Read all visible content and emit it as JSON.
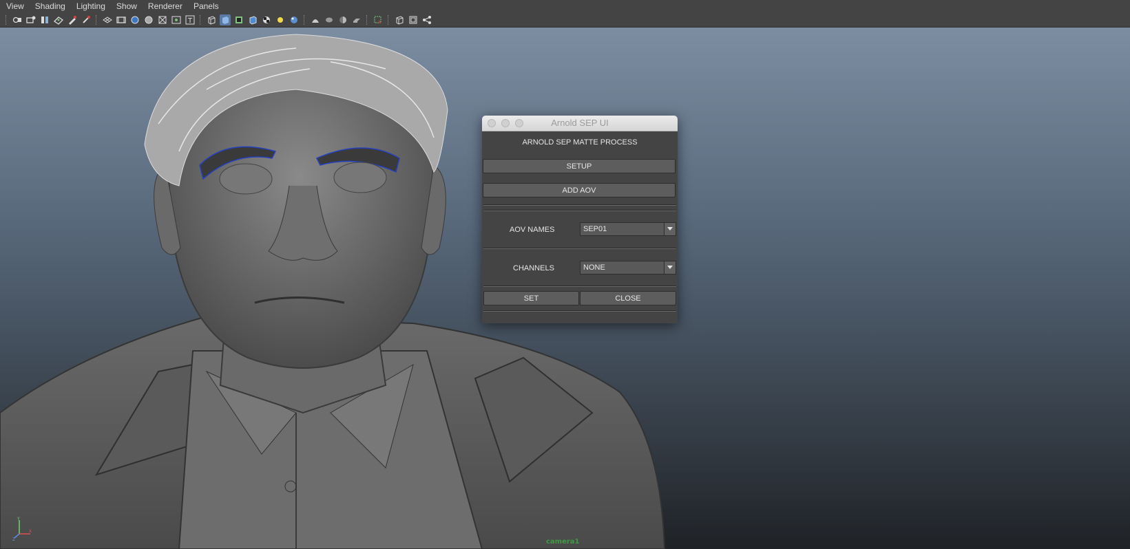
{
  "menubar": {
    "items": [
      "View",
      "Shading",
      "Lighting",
      "Show",
      "Renderer",
      "Panels"
    ]
  },
  "toolbar": {
    "icons": [
      "camera-select-icon",
      "camera-attributes-icon",
      "bookmark-icon",
      "image-plane-icon",
      "grease-pencil-icon",
      "2d-pan-zoom-icon",
      "grid-icon",
      "film-gate-icon",
      "resolution-gate-icon",
      "gate-mask-icon",
      "field-chart-icon",
      "safe-action-icon",
      "safe-title-icon",
      "wireframe-icon",
      "smooth-shade-icon",
      "wireframe-on-shaded-icon",
      "textured-icon",
      "use-lights-icon",
      "shadows-icon",
      "screen-space-ao-icon",
      "motion-blur-icon",
      "multisample-aa-icon",
      "depth-of-field-icon",
      "isolate-select-icon",
      "xray-icon",
      "xray-joints-icon",
      "xray-components-icon"
    ]
  },
  "viewport": {
    "camera_name": "camera1"
  },
  "dialog": {
    "title": "Arnold SEP UI",
    "heading": "ARNOLD SEP MATTE PROCESS",
    "setup_label": "SETUP",
    "add_aov_label": "ADD AOV",
    "aov_names_label": "AOV NAMES",
    "aov_names_value": "SEP01",
    "channels_label": "CHANNELS",
    "channels_value": "NONE",
    "set_label": "SET",
    "close_label": "CLOSE"
  }
}
